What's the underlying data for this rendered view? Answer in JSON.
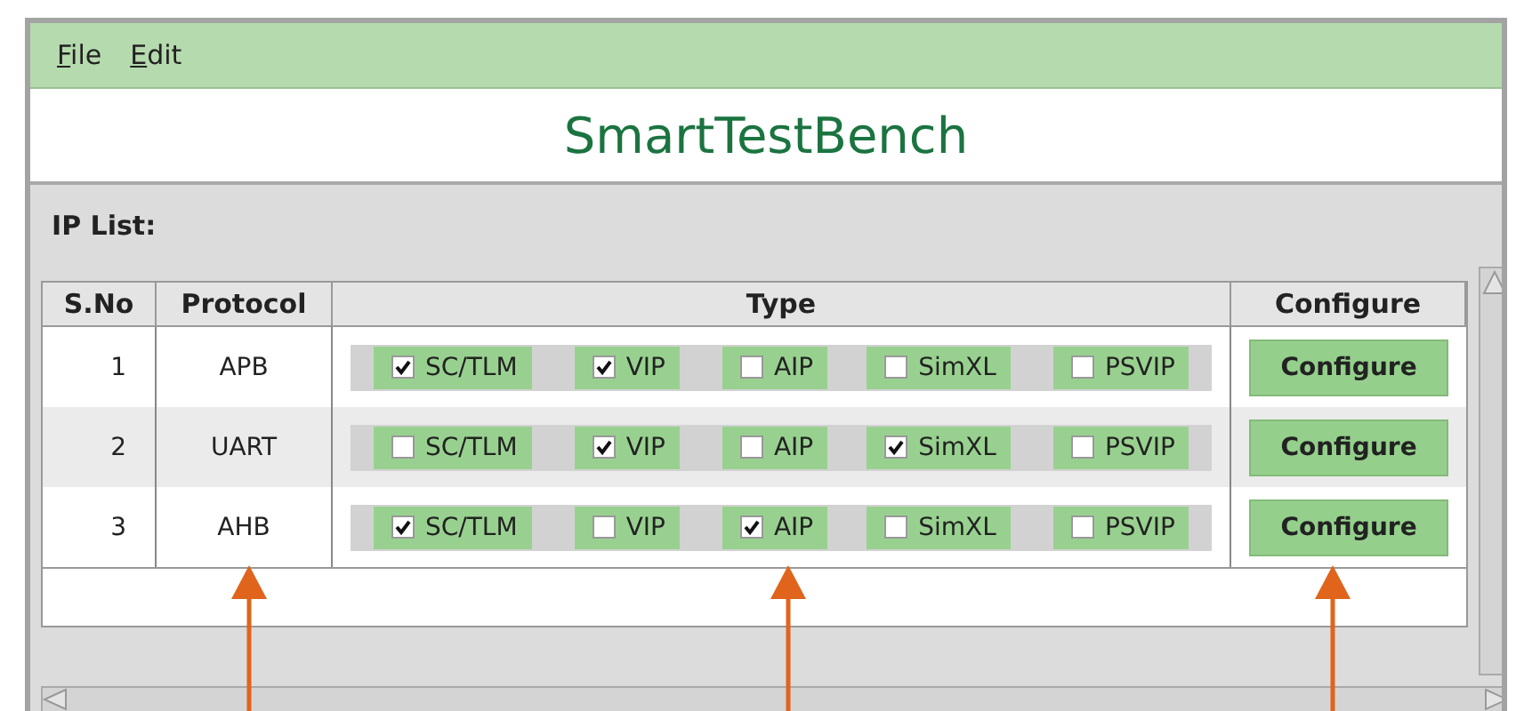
{
  "menu": [
    "File",
    "Edit"
  ],
  "app_title": "SmartTestBench",
  "section_label": "IP List:",
  "table": {
    "columns": [
      "S.No",
      "Protocol",
      "Type",
      "Configure"
    ],
    "rows": [
      {
        "sno": "1",
        "protocol": "APB",
        "types": [
          {
            "label": "SC/TLM",
            "checked": true
          },
          {
            "label": "VIP",
            "checked": true
          },
          {
            "label": "AIP",
            "checked": false
          },
          {
            "label": "SimXL",
            "checked": false
          },
          {
            "label": "PSVIP",
            "checked": false
          }
        ],
        "button": "Configure"
      },
      {
        "sno": "2",
        "protocol": "UART",
        "types": [
          {
            "label": "SC/TLM",
            "checked": false
          },
          {
            "label": "VIP",
            "checked": true
          },
          {
            "label": "AIP",
            "checked": false
          },
          {
            "label": "SimXL",
            "checked": true
          },
          {
            "label": "PSVIP",
            "checked": false
          }
        ],
        "button": "Configure"
      },
      {
        "sno": "3",
        "protocol": "AHB",
        "types": [
          {
            "label": "SC/TLM",
            "checked": true
          },
          {
            "label": "VIP",
            "checked": false
          },
          {
            "label": "AIP",
            "checked": true
          },
          {
            "label": "SimXL",
            "checked": false
          },
          {
            "label": "PSVIP",
            "checked": false
          }
        ],
        "button": "Configure"
      }
    ]
  }
}
